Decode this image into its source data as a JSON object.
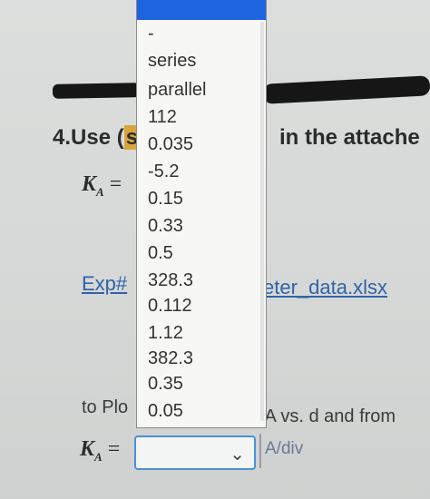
{
  "question": {
    "number_label": "4.Use (",
    "highlight": "s",
    "rest": "in the attache"
  },
  "ka_label": "K",
  "ka_sub": "A",
  "eq": "=",
  "links": {
    "exp": "Exp#",
    "file": "eter_data.xlsx"
  },
  "plot_text": "to Plo",
  "ia_text": "IA vs. d and from",
  "unit": "A/div",
  "dropdown": {
    "options": [
      "-",
      "series",
      "parallel",
      "112",
      "0.035",
      "-5.2",
      "0.15",
      "0.33",
      "0.5",
      "328.3",
      "0.112",
      "1.12",
      "382.3",
      "0.35",
      "0.05"
    ]
  },
  "select": {
    "value": ""
  }
}
